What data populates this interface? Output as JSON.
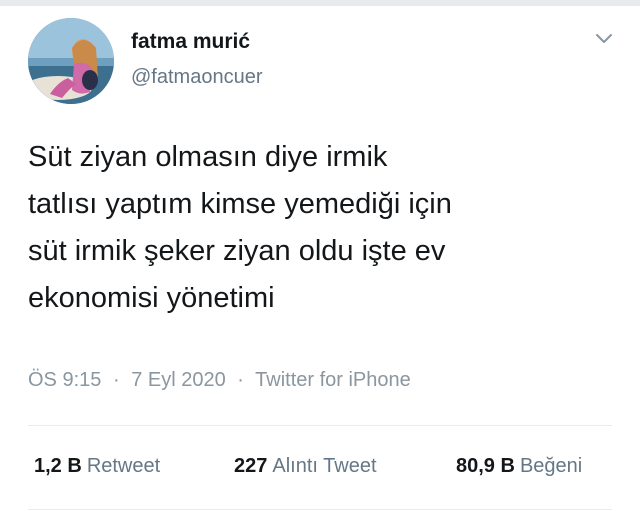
{
  "author": {
    "display_name": "fatma murić",
    "handle": "@fatmaoncuer",
    "avatar_icon": "profile-photo"
  },
  "menu_icon": "chevron-down-icon",
  "tweet": {
    "lines": [
      "Süt ziyan olmasın diye irmik",
      "tatlısı yaptım kimse yemediği için",
      "süt irmik şeker ziyan oldu işte ev",
      "ekonomisi yönetimi"
    ]
  },
  "meta": {
    "time": "ÖS 9:15",
    "separator": "·",
    "date": "7 Eyl 2020",
    "source": "Twitter for iPhone"
  },
  "stats": {
    "retweets": {
      "count": "1,2 B",
      "label": "Retweet"
    },
    "quotes": {
      "count": "227",
      "label": "Alıntı Tweet"
    },
    "likes": {
      "count": "80,9 B",
      "label": "Beğeni"
    }
  },
  "colors": {
    "text": "#14171a",
    "secondary": "#657786",
    "meta": "#8a96a0",
    "divider": "#e6ecf0"
  }
}
